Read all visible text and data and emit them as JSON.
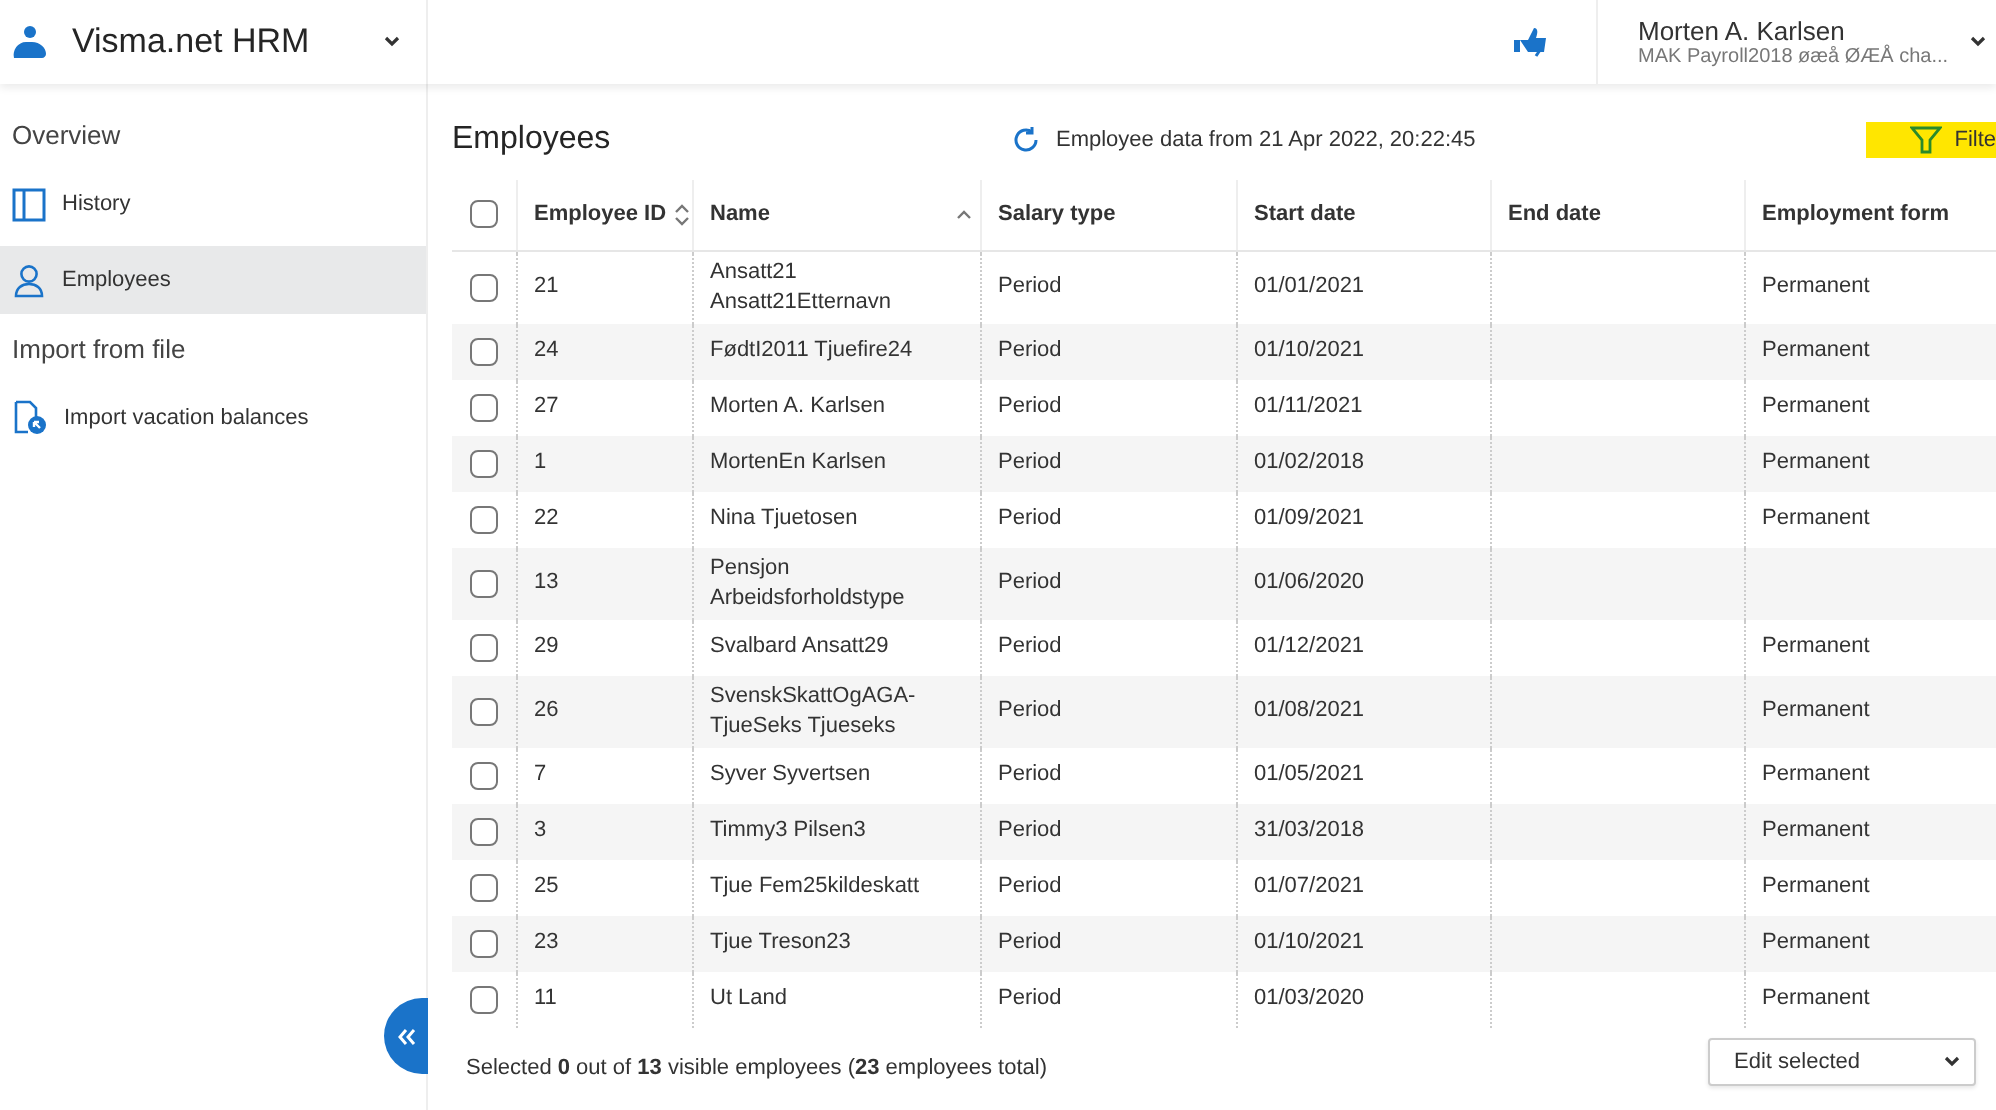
{
  "app": {
    "title": "Visma.net HRM"
  },
  "user": {
    "name": "Morten A. Karlsen",
    "company": "MAK Payroll2018 øæå ØÆÅ cha..."
  },
  "sidebar": {
    "sections": [
      {
        "heading": "Overview",
        "items": [
          {
            "label": "History",
            "kind": "panel",
            "selected": false
          },
          {
            "label": "Employees",
            "kind": "person",
            "selected": true
          }
        ]
      },
      {
        "heading": "Import from file",
        "items": [
          {
            "label": "Import vacation balances",
            "kind": "import",
            "selected": false
          }
        ]
      }
    ]
  },
  "page": {
    "title": "Employees",
    "refresh_text": "Employee data from 21 Apr 2022, 20:22:45",
    "filter_label": "Filte"
  },
  "table": {
    "select_all_checked": false,
    "columns": [
      {
        "label": "Employee ID",
        "kind": "sortable"
      },
      {
        "label": "Name",
        "kind": "sorted"
      },
      {
        "label": "Salary type",
        "kind": "plain"
      },
      {
        "label": "Start date",
        "kind": "plain"
      },
      {
        "label": "End date",
        "kind": "plain"
      },
      {
        "label": "Employment form",
        "kind": "plain"
      }
    ],
    "rows": [
      {
        "checked": false,
        "cells": [
          "21",
          "Ansatt21 Ansatt21Etternavn",
          "Period",
          "01/01/2021",
          "",
          "Permanent"
        ]
      },
      {
        "checked": false,
        "cells": [
          "24",
          "FødtI2011 Tjuefire24",
          "Period",
          "01/10/2021",
          "",
          "Permanent"
        ]
      },
      {
        "checked": false,
        "cells": [
          "27",
          "Morten A. Karlsen",
          "Period",
          "01/11/2021",
          "",
          "Permanent"
        ]
      },
      {
        "checked": false,
        "cells": [
          "1",
          "MortenEn Karlsen",
          "Period",
          "01/02/2018",
          "",
          "Permanent"
        ]
      },
      {
        "checked": false,
        "cells": [
          "22",
          "Nina Tjuetosen",
          "Period",
          "01/09/2021",
          "",
          "Permanent"
        ]
      },
      {
        "checked": false,
        "cells": [
          "13",
          "Pensjon Arbeidsforholdstype",
          "Period",
          "01/06/2020",
          "",
          ""
        ]
      },
      {
        "checked": false,
        "cells": [
          "29",
          "Svalbard Ansatt29",
          "Period",
          "01/12/2021",
          "",
          "Permanent"
        ]
      },
      {
        "checked": false,
        "cells": [
          "26",
          "SvenskSkattOgAGA-TjueSeks Tjueseks",
          "Period",
          "01/08/2021",
          "",
          "Permanent"
        ]
      },
      {
        "checked": false,
        "cells": [
          "7",
          "Syver Syvertsen",
          "Period",
          "01/05/2021",
          "",
          "Permanent"
        ]
      },
      {
        "checked": false,
        "cells": [
          "3",
          "Timmy3 Pilsen3",
          "Period",
          "31/03/2018",
          "",
          "Permanent"
        ]
      },
      {
        "checked": false,
        "cells": [
          "25",
          "Tjue Fem25kildeskatt",
          "Period",
          "01/07/2021",
          "",
          "Permanent"
        ]
      },
      {
        "checked": false,
        "cells": [
          "23",
          "Tjue Treson23",
          "Period",
          "01/10/2021",
          "",
          "Permanent"
        ]
      },
      {
        "checked": false,
        "cells": [
          "11",
          "Ut Land",
          "Period",
          "01/03/2020",
          "",
          "Permanent"
        ]
      }
    ]
  },
  "footer": {
    "summary": "Selected **0** out of **13** visible employees (**23** employees total)",
    "action": "Edit selected"
  }
}
